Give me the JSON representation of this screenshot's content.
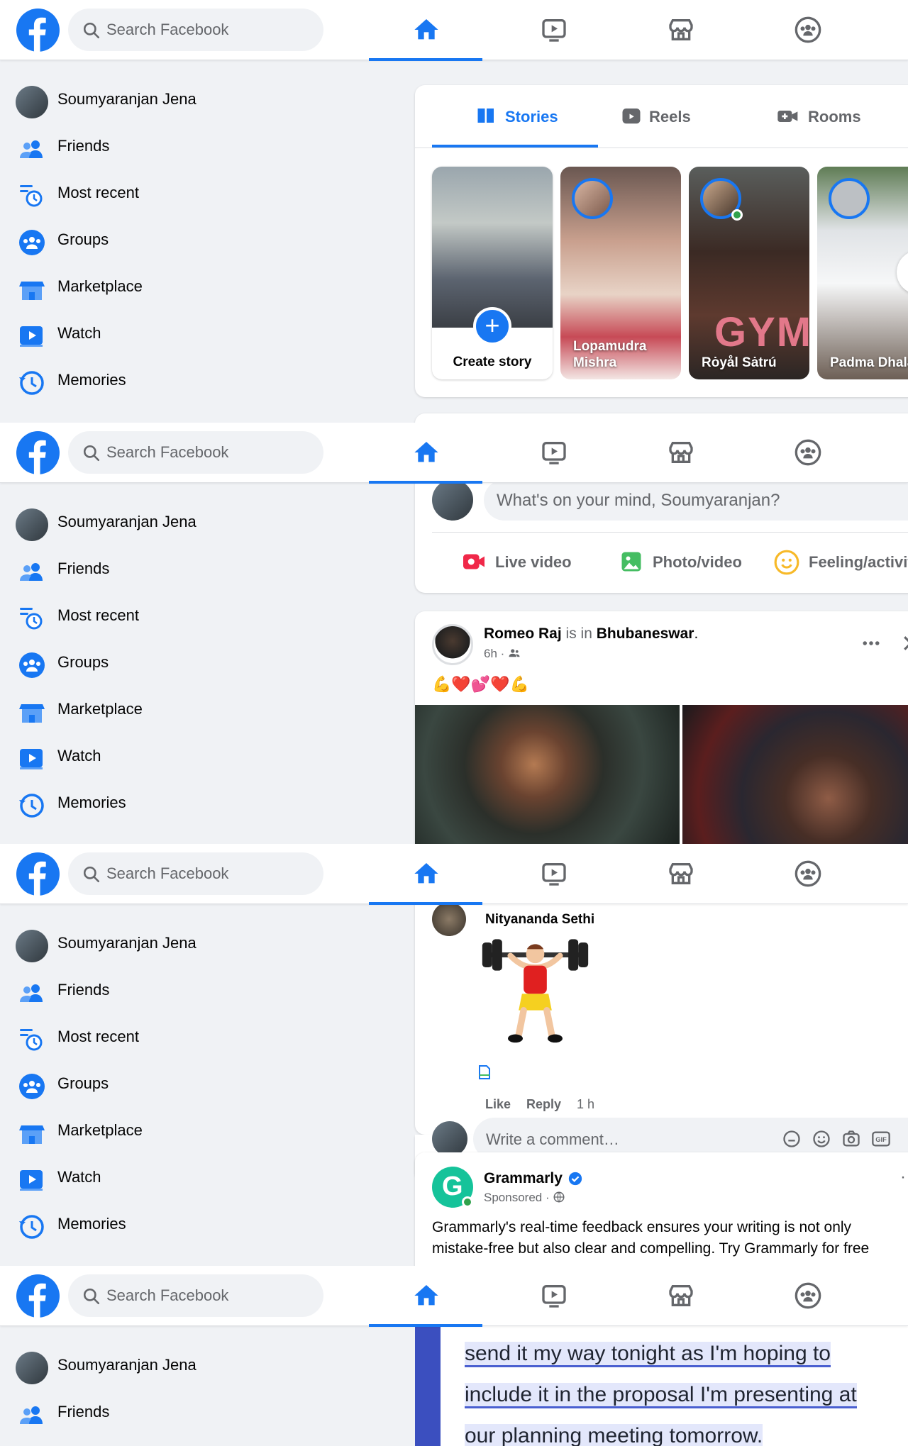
{
  "colors": {
    "brand": "#1877f2",
    "bg": "#f0f2f5",
    "text": "#050505",
    "muted": "#65676b",
    "live": "#f02849",
    "photo": "#45bd62",
    "feeling": "#f7b928",
    "grammarly": "#15c39a"
  },
  "header": {
    "search_placeholder": "Search Facebook"
  },
  "sidebar": {
    "items": [
      {
        "label": "Soumyaranjan Jena",
        "icon": "profile-avatar"
      },
      {
        "label": "Friends",
        "icon": "friends-icon"
      },
      {
        "label": "Most recent",
        "icon": "most-recent-icon"
      },
      {
        "label": "Groups",
        "icon": "groups-icon"
      },
      {
        "label": "Marketplace",
        "icon": "marketplace-icon"
      },
      {
        "label": "Watch",
        "icon": "watch-icon"
      },
      {
        "label": "Memories",
        "icon": "memories-icon"
      }
    ]
  },
  "stories": {
    "tabs": [
      "Stories",
      "Reels",
      "Rooms"
    ],
    "create_label": "Create story",
    "items": [
      {
        "name": "Lopamudra Mishra"
      },
      {
        "name": "Rȯyål Sȧtrú",
        "overlay": "GYM"
      },
      {
        "name": "Padma Dhala"
      }
    ]
  },
  "composer": {
    "placeholder": "What's on your mind, Soumyaranjan?",
    "actions": [
      "Live video",
      "Photo/video",
      "Feeling/activit"
    ]
  },
  "post": {
    "author": "Romeo Raj",
    "is_in": "is in",
    "place": "Bhubaneswar",
    "time": "6h ·",
    "emoji_text": "💪❤️💕❤️💪"
  },
  "comment": {
    "author": "Nityananda Sethi",
    "like": "Like",
    "reply": "Reply",
    "time": "1 h",
    "write_placeholder": "Write a comment…"
  },
  "ad": {
    "name": "Grammarly",
    "sponsored": "Sponsored ·",
    "body_line1": "Grammarly's real-time feedback ensures your writing is not only",
    "body_line2": "mistake-free but also clear and compelling. Try Grammarly for free",
    "doc_lines": [
      "send it my way tonight as I'm hoping to",
      "include it in the proposal I'm presenting at",
      "our planning meeting tomorrow."
    ]
  }
}
